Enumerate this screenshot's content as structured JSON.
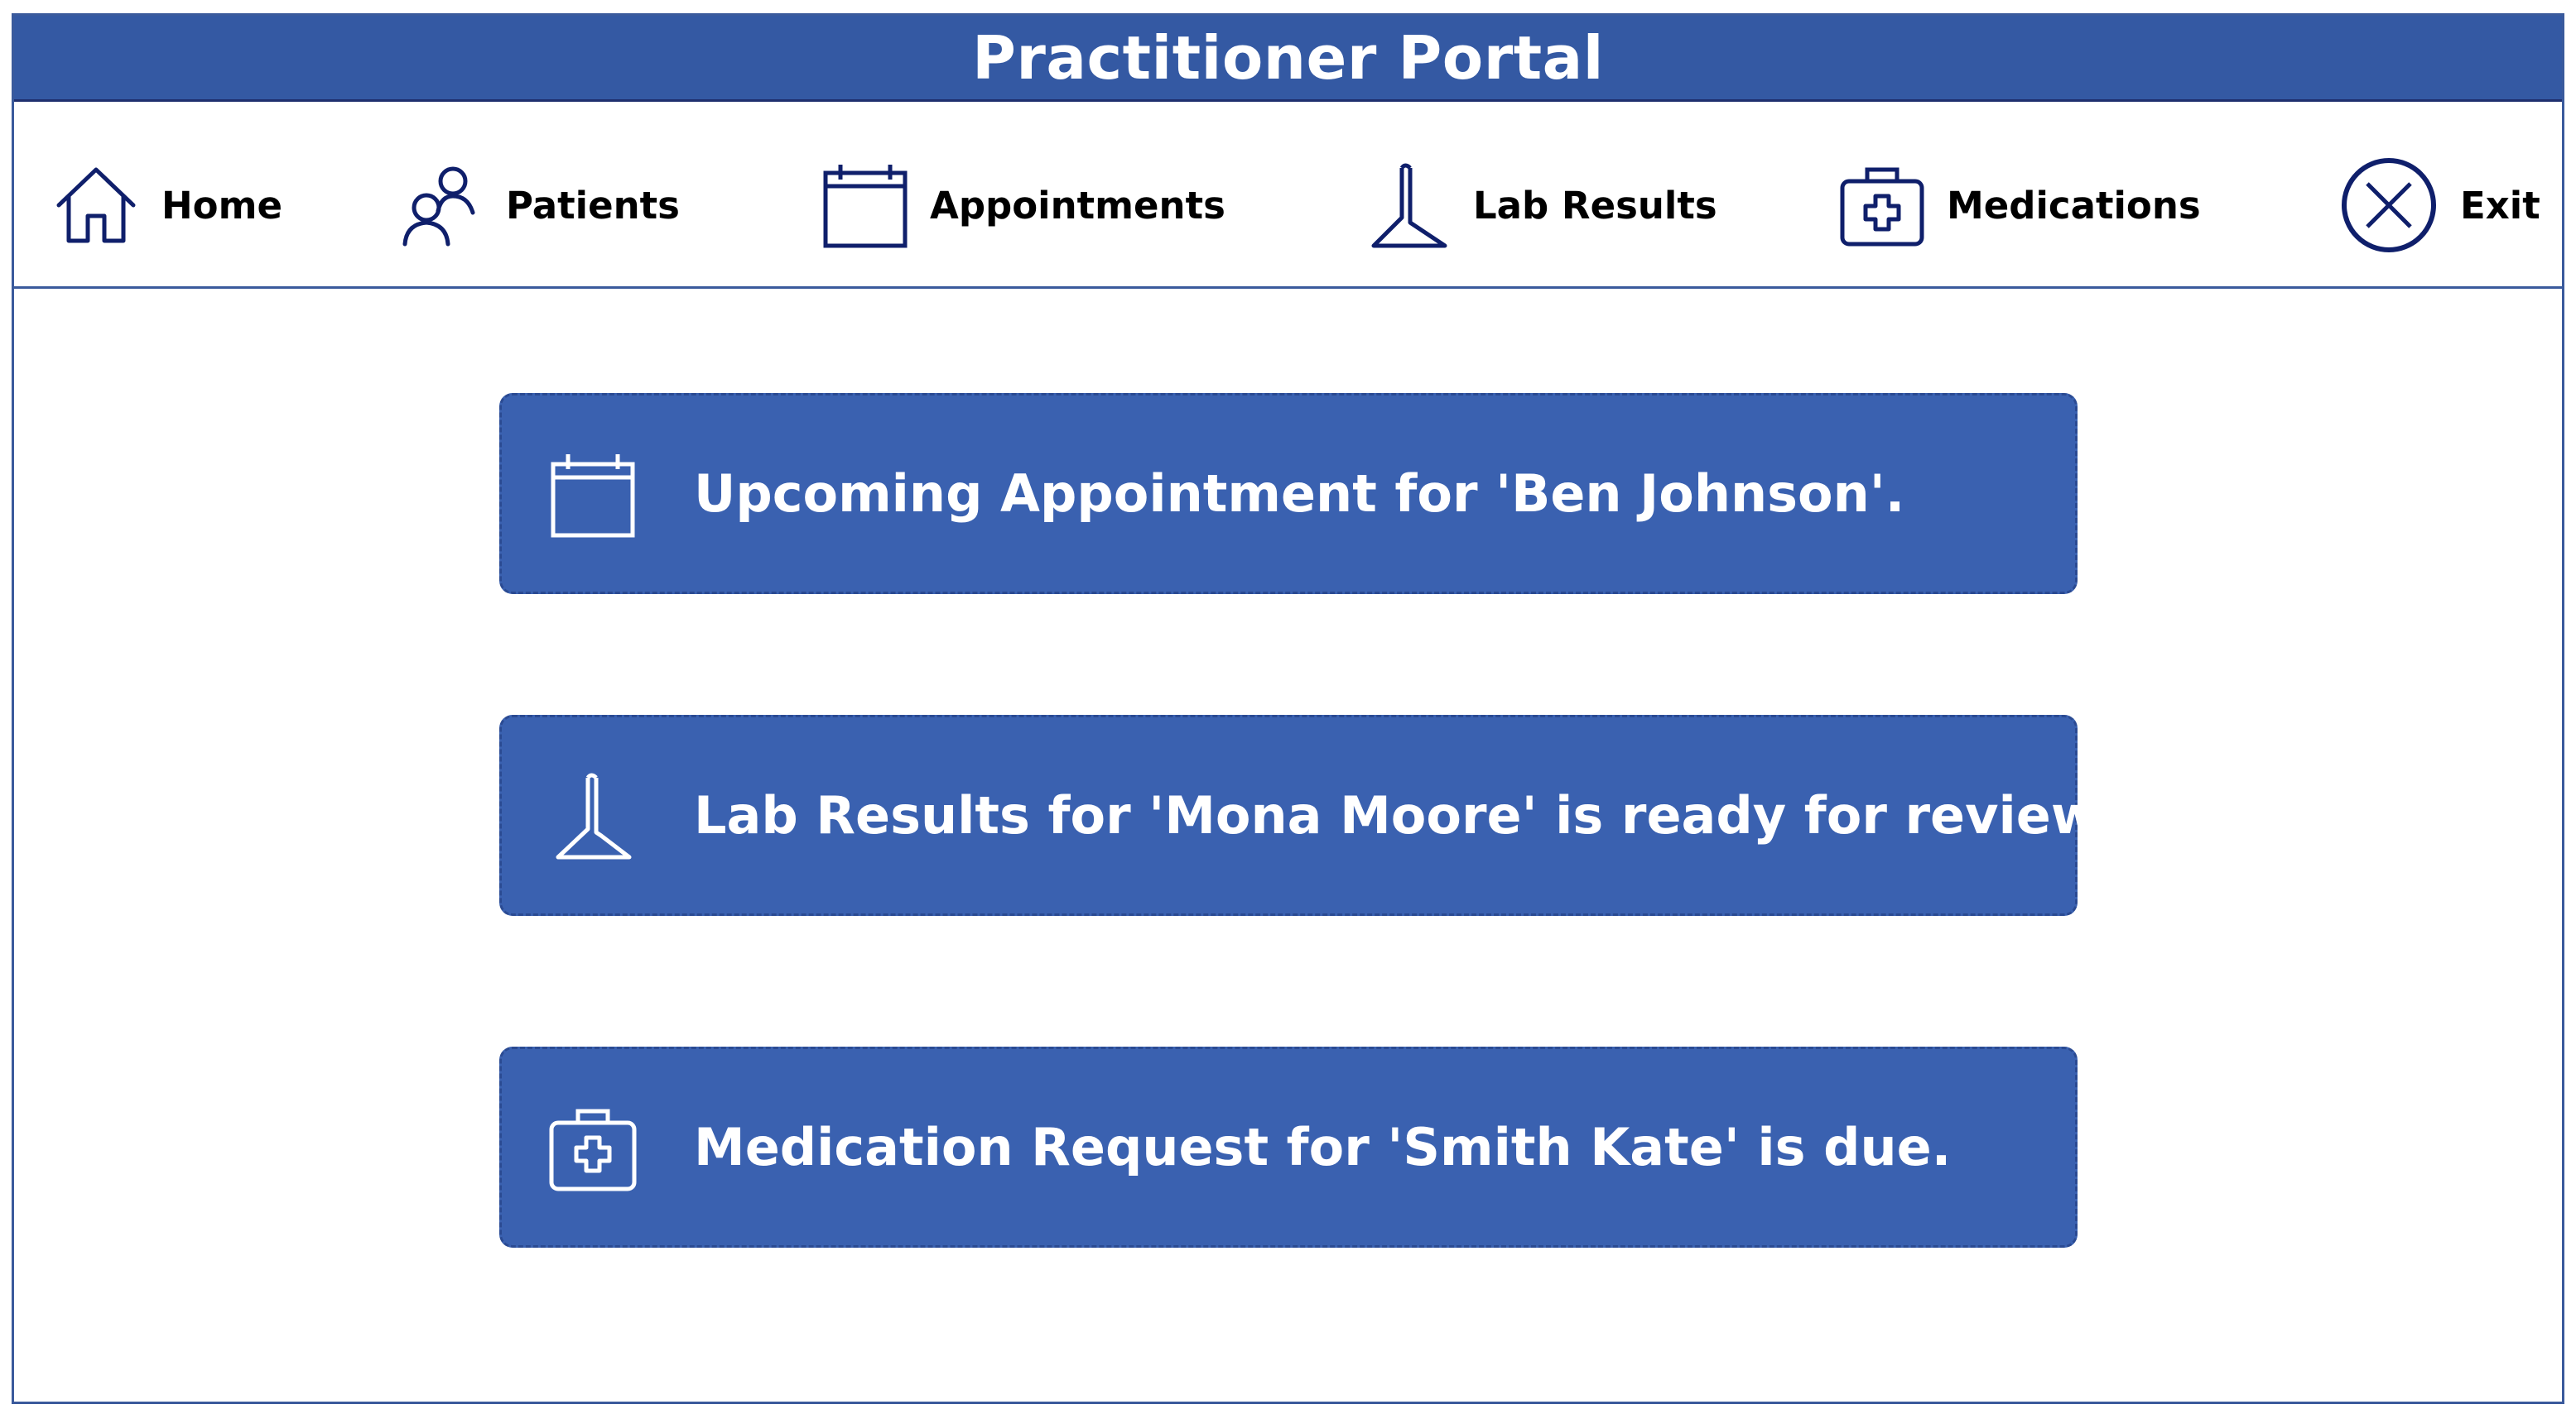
{
  "app": {
    "title": "Practitioner Portal"
  },
  "nav": {
    "items": [
      {
        "label": "Home",
        "icon": "home-icon"
      },
      {
        "label": "Patients",
        "icon": "people-icon"
      },
      {
        "label": "Appointments",
        "icon": "calendar-icon"
      },
      {
        "label": "Lab Results",
        "icon": "flask-icon"
      },
      {
        "label": "Medications",
        "icon": "medkit-icon"
      },
      {
        "label": "Exit",
        "icon": "close-circle-icon"
      }
    ]
  },
  "notifications": [
    {
      "text": "Upcoming Appointment for 'Ben Johnson'.",
      "icon": "calendar-icon"
    },
    {
      "text": "Lab Results for 'Mona Moore' is ready for review.",
      "icon": "flask-icon"
    },
    {
      "text": "Medication Request for 'Smith Kate' is due.",
      "icon": "medkit-icon"
    }
  ],
  "colors": {
    "header_bg": "#3459a3",
    "card_bg": "#3a61b0",
    "nav_icon": "#0f1f6b",
    "frame_border": "#3a5a9c"
  }
}
